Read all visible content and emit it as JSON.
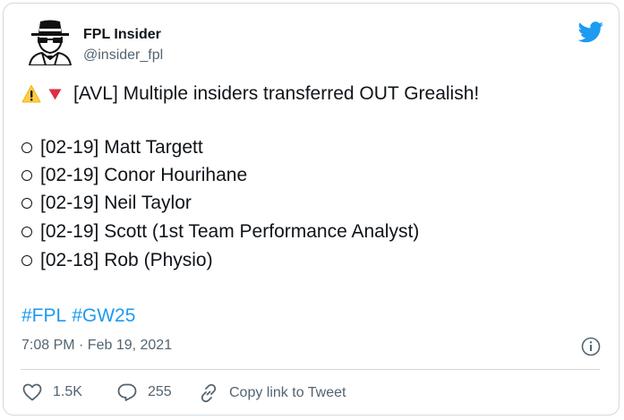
{
  "tweet": {
    "author_name": "FPL Insider",
    "handle": "@insider_fpl",
    "headline": "[AVL] Multiple insiders transferred OUT Grealish!",
    "entries": [
      "[02-19] Matt Targett",
      "[02-19] Conor Hourihane",
      "[02-19] Neil Taylor",
      "[02-19] Scott (1st Team Performance Analyst)",
      "[02-18] Rob (Physio)"
    ],
    "hashtags": [
      "#FPL",
      "#GW25"
    ],
    "timestamp": "7:08 PM · Feb 19, 2021"
  },
  "actions": {
    "likes": "1.5K",
    "replies": "255",
    "copy_link_label": "Copy link to Tweet"
  },
  "icons": {
    "brand": "twitter-bird-icon",
    "warning": "warning-icon",
    "down": "red-triangle-down-icon",
    "info": "info-icon",
    "like": "heart-icon",
    "reply": "reply-icon",
    "link": "link-icon"
  },
  "colors": {
    "twitter_blue": "#1d9bf0",
    "warning_yellow": "#ffcc4d",
    "red_triangle": "#dd2e44",
    "secondary_text": "#536471"
  }
}
